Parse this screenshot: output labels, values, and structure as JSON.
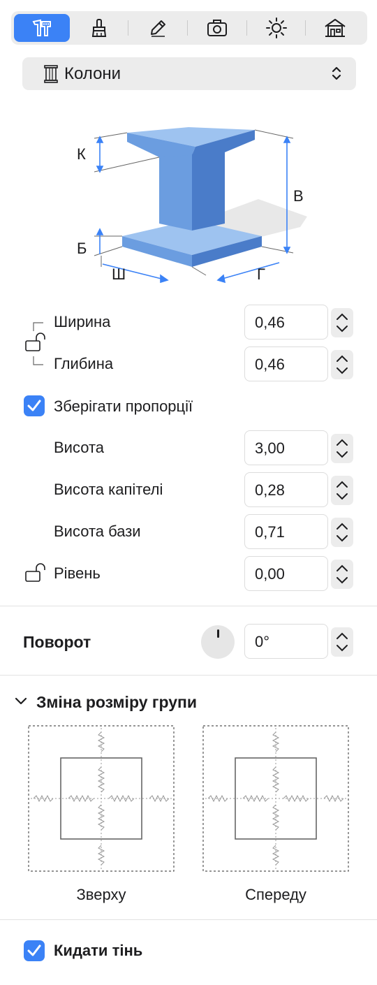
{
  "tabs": [
    {
      "icon": "dimensions-icon",
      "active": true
    },
    {
      "icon": "brush-icon",
      "active": false
    },
    {
      "icon": "pencil-icon",
      "active": false
    },
    {
      "icon": "camera-icon",
      "active": false
    },
    {
      "icon": "sun-icon",
      "active": false
    },
    {
      "icon": "building-icon",
      "active": false
    }
  ],
  "object_type": {
    "label": "Колони",
    "icon": "column-icon"
  },
  "diagram": {
    "k": "К",
    "b": "Б",
    "v": "В",
    "sh": "Ш",
    "h": "Г"
  },
  "dimensions": {
    "width": {
      "label": "Ширина",
      "value": "0,46"
    },
    "depth": {
      "label": "Глибина",
      "value": "0,46"
    },
    "keep_proportions": {
      "label": "Зберігати пропорції",
      "checked": true
    },
    "height": {
      "label": "Висота",
      "value": "3,00"
    },
    "capital_height": {
      "label": "Висота капітелі",
      "value": "0,28"
    },
    "base_height": {
      "label": "Висота бази",
      "value": "0,71"
    },
    "level": {
      "label": "Рівень",
      "value": "0,00"
    }
  },
  "rotation": {
    "label": "Поворот",
    "value": "0°"
  },
  "group_resize": {
    "title": "Зміна розміру групи",
    "top_label": "Зверху",
    "front_label": "Спереду"
  },
  "cast_shadow": {
    "label": "Кидати тінь",
    "checked": true
  },
  "colors": {
    "accent": "#3b82f6",
    "column_light": "#9ec3f0",
    "column_mid": "#6b9de0",
    "column_dark": "#4a7cc9"
  }
}
